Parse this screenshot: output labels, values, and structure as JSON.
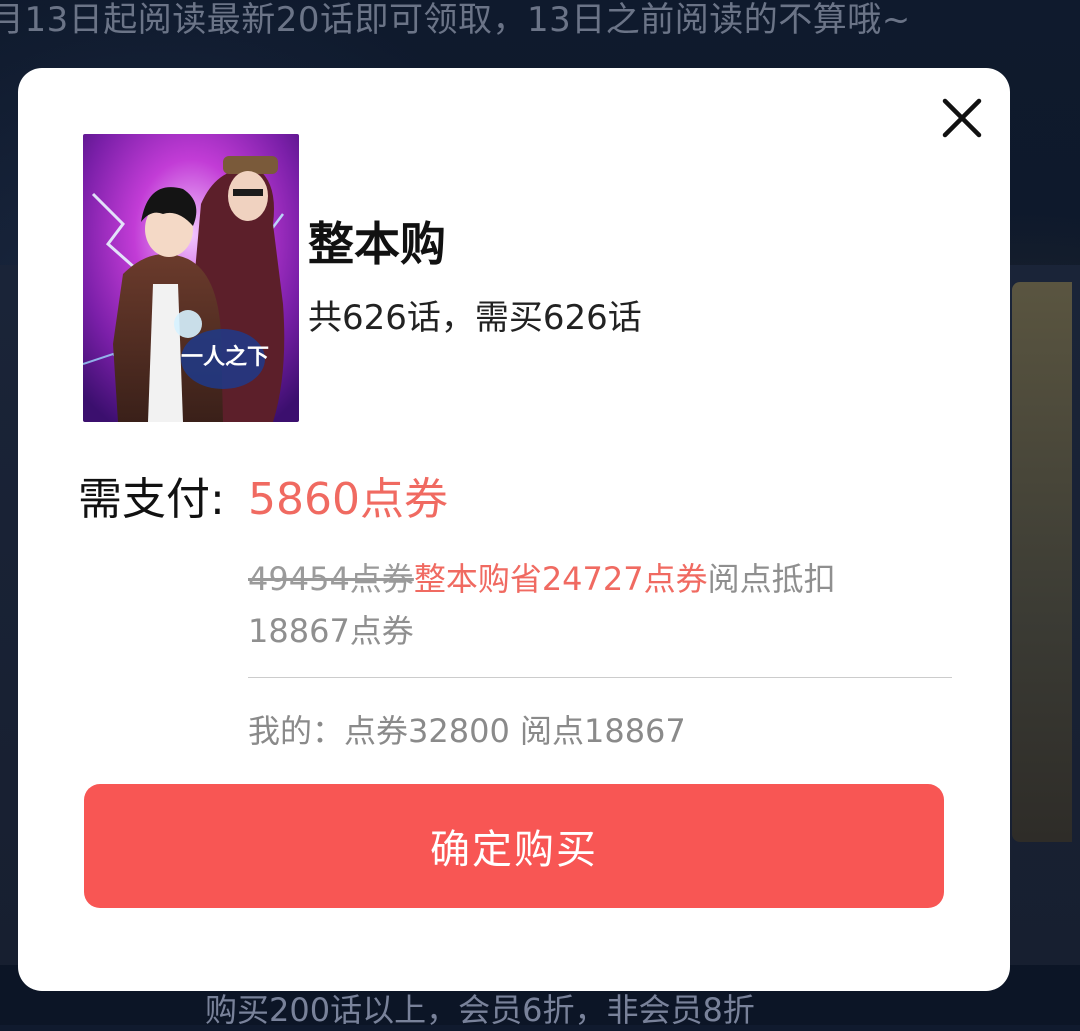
{
  "background": {
    "top_notice": "月13日起阅读最新20话即可领取，13日之前阅读的不算哦~",
    "bottom_notice": "购买200话以上，会员6折，非会员8折"
  },
  "dialog": {
    "close_icon": "close-icon",
    "cover_alt": "一人之下",
    "title": "整本购",
    "episode_info": "共626话，需买626话",
    "pay_label": "需支付:",
    "pay_amount": "5860点券",
    "original_price": "49454点券",
    "savings": "整本购省24727点券",
    "deduction_prefix": "阅点抵扣",
    "deduction_amount": "18867点券",
    "balance": "我的：点券32800 阅点18867",
    "confirm_label": "确定购买"
  },
  "colors": {
    "accent": "#f06a61",
    "button": "#f85654"
  }
}
